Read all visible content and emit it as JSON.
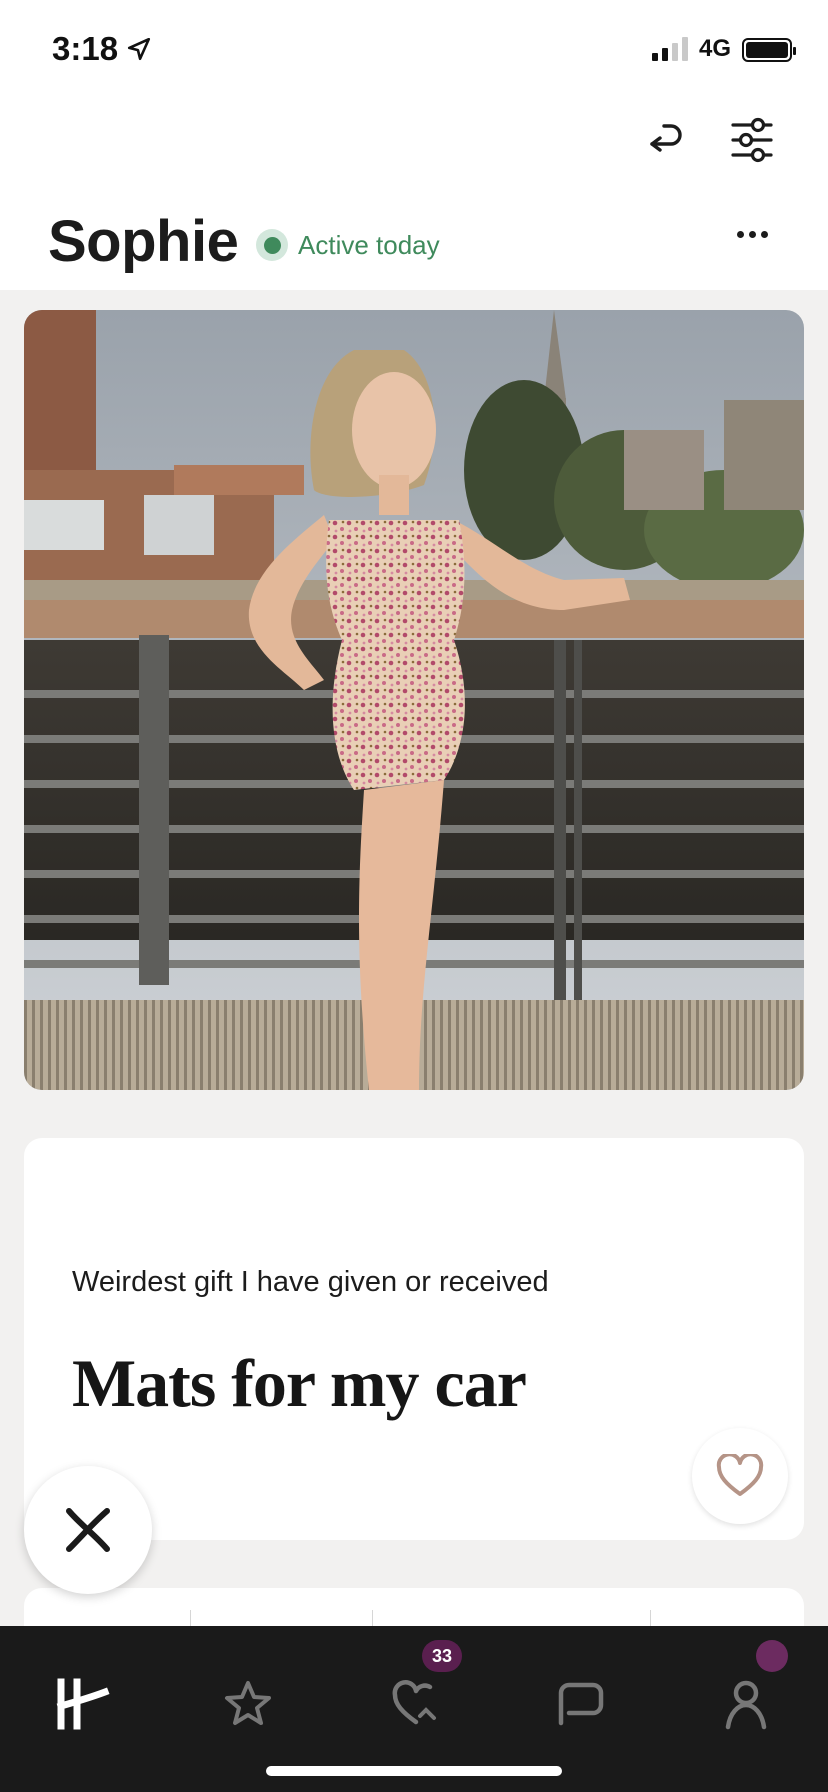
{
  "status_bar": {
    "time": "3:18",
    "network": "4G",
    "location_icon": "location-arrow-icon",
    "signal_bars_active": 2,
    "signal_bars_total": 4
  },
  "header": {
    "undo_icon": "undo-icon",
    "filter_icon": "filter-sliders-icon"
  },
  "profile": {
    "name": "Sophie",
    "status": "Active today",
    "more_icon": "more-dots-icon"
  },
  "photo": {
    "description_icon": "profile-photo",
    "like_icon": "heart-icon"
  },
  "prompt": {
    "question": "Weirdest gift I have given or received",
    "answer": "Mats for my car",
    "like_icon": "heart-icon"
  },
  "dismiss": {
    "icon": "close-icon"
  },
  "tabbar": {
    "tabs": [
      {
        "name": "home",
        "icon": "hinge-logo-icon",
        "active": true
      },
      {
        "name": "standouts",
        "icon": "star-icon",
        "active": false
      },
      {
        "name": "likes",
        "icon": "likes-heart-icon",
        "active": false,
        "badge": "33"
      },
      {
        "name": "matches",
        "icon": "chat-icon",
        "active": false
      },
      {
        "name": "profile",
        "icon": "person-icon",
        "active": false
      }
    ]
  },
  "colors": {
    "accent_green": "#3f8a5c",
    "badge_purple": "#5a1f4f",
    "tabbar": "#1a1a1a",
    "heart": "#b59487"
  }
}
